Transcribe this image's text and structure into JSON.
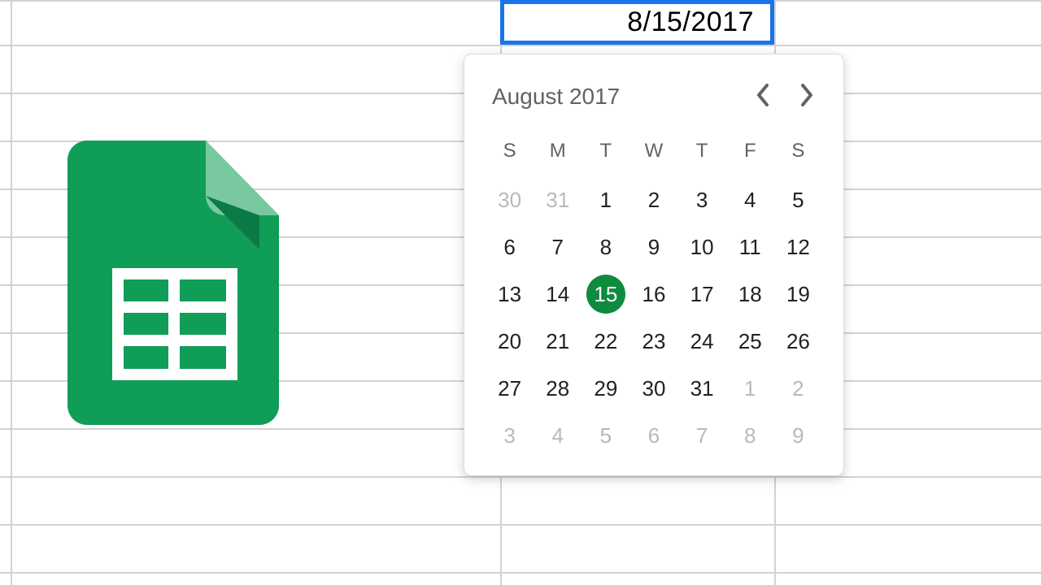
{
  "cell": {
    "value": "8/15/2017"
  },
  "picker": {
    "month_label": "August 2017",
    "dow": [
      "S",
      "M",
      "T",
      "W",
      "T",
      "F",
      "S"
    ],
    "weeks": [
      [
        {
          "n": 30,
          "muted": true
        },
        {
          "n": 31,
          "muted": true
        },
        {
          "n": 1
        },
        {
          "n": 2
        },
        {
          "n": 3
        },
        {
          "n": 4
        },
        {
          "n": 5
        }
      ],
      [
        {
          "n": 6
        },
        {
          "n": 7
        },
        {
          "n": 8
        },
        {
          "n": 9
        },
        {
          "n": 10
        },
        {
          "n": 11
        },
        {
          "n": 12
        }
      ],
      [
        {
          "n": 13
        },
        {
          "n": 14
        },
        {
          "n": 15,
          "selected": true
        },
        {
          "n": 16
        },
        {
          "n": 17
        },
        {
          "n": 18
        },
        {
          "n": 19
        }
      ],
      [
        {
          "n": 20
        },
        {
          "n": 21
        },
        {
          "n": 22
        },
        {
          "n": 23
        },
        {
          "n": 24
        },
        {
          "n": 25
        },
        {
          "n": 26
        }
      ],
      [
        {
          "n": 27
        },
        {
          "n": 28
        },
        {
          "n": 29
        },
        {
          "n": 30
        },
        {
          "n": 31
        },
        {
          "n": 1,
          "muted": true
        },
        {
          "n": 2,
          "muted": true
        }
      ],
      [
        {
          "n": 3,
          "muted": true
        },
        {
          "n": 4,
          "muted": true
        },
        {
          "n": 5,
          "muted": true
        },
        {
          "n": 6,
          "muted": true
        },
        {
          "n": 7,
          "muted": true
        },
        {
          "n": 8,
          "muted": true
        },
        {
          "n": 9,
          "muted": true
        }
      ]
    ],
    "nav": {
      "prev": "‹",
      "next": "›"
    }
  },
  "colors": {
    "accent": "#1a73e8",
    "selected_day": "#0f8b3f",
    "logo": "#0f9d58"
  }
}
